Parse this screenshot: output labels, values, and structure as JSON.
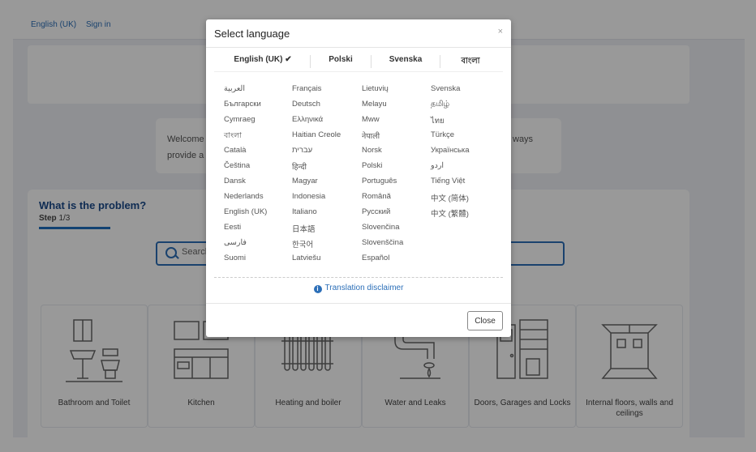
{
  "header": {
    "language_link": "English (UK)",
    "sign_in": "Sign in"
  },
  "welcome": {
    "line1": "Welcome",
    "line2": "provide a",
    "right": "ways"
  },
  "problem": {
    "title": "What is the problem?",
    "step_label": "Step",
    "step_value": "1/3"
  },
  "search": {
    "placeholder": "Search"
  },
  "categories": [
    {
      "label": "Bathroom and Toilet",
      "icon": "toilet-icon"
    },
    {
      "label": "Kitchen",
      "icon": "kitchen-icon"
    },
    {
      "label": "Heating and boiler",
      "icon": "radiator-icon"
    },
    {
      "label": "Water and Leaks",
      "icon": "pipe-icon"
    },
    {
      "label": "Doors, Garages and Locks",
      "icon": "door-icon"
    },
    {
      "label": "Internal floors, walls and ceilings",
      "icon": "room-icon"
    }
  ],
  "modal": {
    "title": "Select language",
    "close_x": "×",
    "top_languages": [
      {
        "label": "English (UK) ✔"
      },
      {
        "label": "Polski"
      },
      {
        "label": "Svenska"
      },
      {
        "label": "বাংলা"
      }
    ],
    "languages": [
      [
        "العربية",
        "Български",
        "Cymraeg",
        "বাংলা",
        "Català",
        "Čeština",
        "Dansk",
        "Nederlands",
        "English (UK)",
        "Eesti",
        "فارسی",
        "Suomi"
      ],
      [
        "Français",
        "Deutsch",
        "Ελληνικά",
        "Haitian Creole",
        "עברית",
        "हिन्दी",
        "Magyar",
        "Indonesia",
        "Italiano",
        "日本語",
        "한국어",
        "Latviešu"
      ],
      [
        "Lietuvių",
        "Melayu",
        "Mww",
        "नेपाली",
        "Norsk",
        "Polski",
        "Português",
        "Română",
        "Русский",
        "Slovenčina",
        "Slovenščina",
        "Español"
      ],
      [
        "Svenska",
        "தமிழ்",
        "ไทย",
        "Türkçe",
        "Українська",
        "اردو",
        "Tiếng Việt",
        "中文 (简体)",
        "中文 (繁體)"
      ]
    ],
    "disclaimer": "Translation disclaimer",
    "close_button": "Close"
  }
}
